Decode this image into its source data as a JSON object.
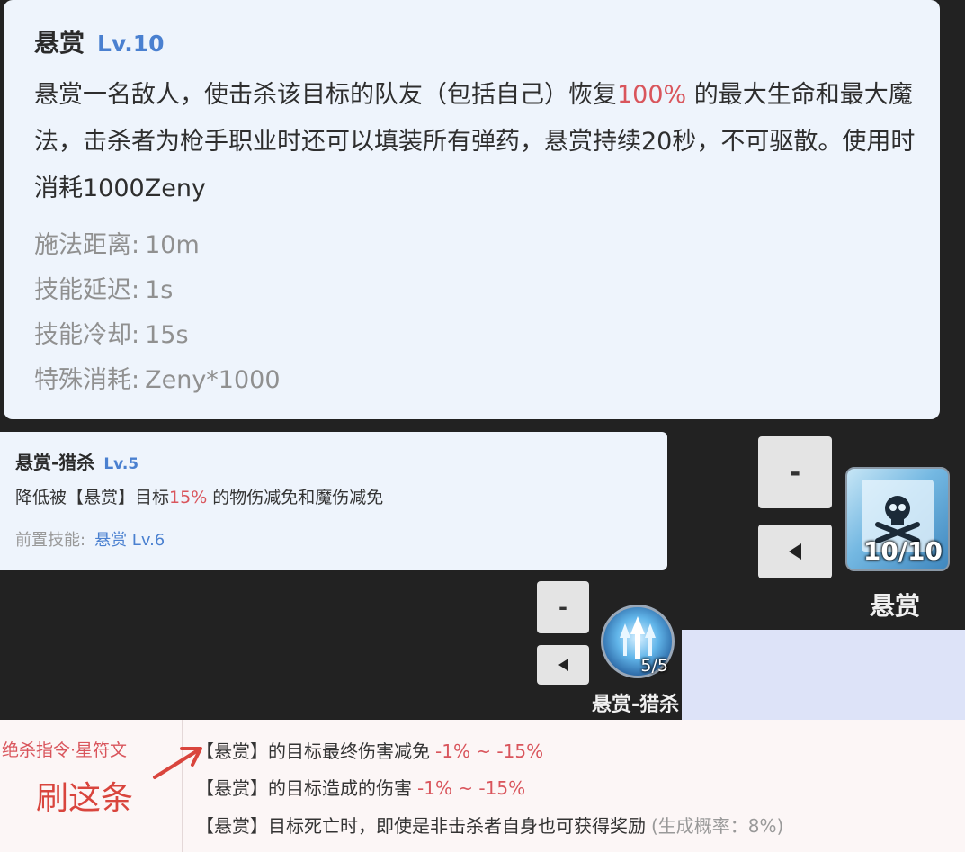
{
  "main_tooltip": {
    "title": "悬赏",
    "level": "Lv.10",
    "desc_before": "悬赏一名敌人，使击杀该目标的队友（包括自己）恢复",
    "desc_highlight": "100%",
    "desc_after": "的最大生命和最大魔法，击杀者为枪手职业时还可以填装所有弹药，悬赏持续20秒，不可驱散。使用时消耗1000Zeny",
    "stats": [
      {
        "label": "施法距离:",
        "value": "10m"
      },
      {
        "label": "技能延迟:",
        "value": "1s"
      },
      {
        "label": "技能冷却:",
        "value": "15s"
      },
      {
        "label": "特殊消耗:",
        "value": "Zeny*1000"
      }
    ]
  },
  "hunt_tooltip": {
    "title": "悬赏-猎杀",
    "level": "Lv.5",
    "desc_before": "降低被【悬赏】目标",
    "desc_highlight": "15%",
    "desc_after": "的物伤减免和魔伤减免",
    "prereq_label": "前置技能:",
    "prereq_link": "悬赏 Lv.6"
  },
  "skills": {
    "bounty": {
      "name": "悬赏",
      "count": "10/10",
      "minus_label": "-",
      "icon": "skull-scroll-icon"
    },
    "hunt": {
      "name": "悬赏-猎杀",
      "count": "5/5",
      "minus_label": "-",
      "icon": "arrows-burst-icon"
    }
  },
  "rune": {
    "name": "绝杀指令·星符文",
    "annotation": "刷这条",
    "lines": [
      {
        "text": "【悬赏】的目标最终伤害减免",
        "range": "-1% ~ -15%",
        "note": ""
      },
      {
        "text": "【悬赏】的目标造成的伤害",
        "range": "-1% ~ -15%",
        "note": ""
      },
      {
        "text": "【悬赏】目标死亡时，即使是非击杀者自身也可获得奖励",
        "range": "",
        "note": "(生成概率：8%)"
      }
    ]
  },
  "colors": {
    "accent": "#4a80d0",
    "highlight": "#d9555c",
    "annotation": "#d9453d"
  }
}
